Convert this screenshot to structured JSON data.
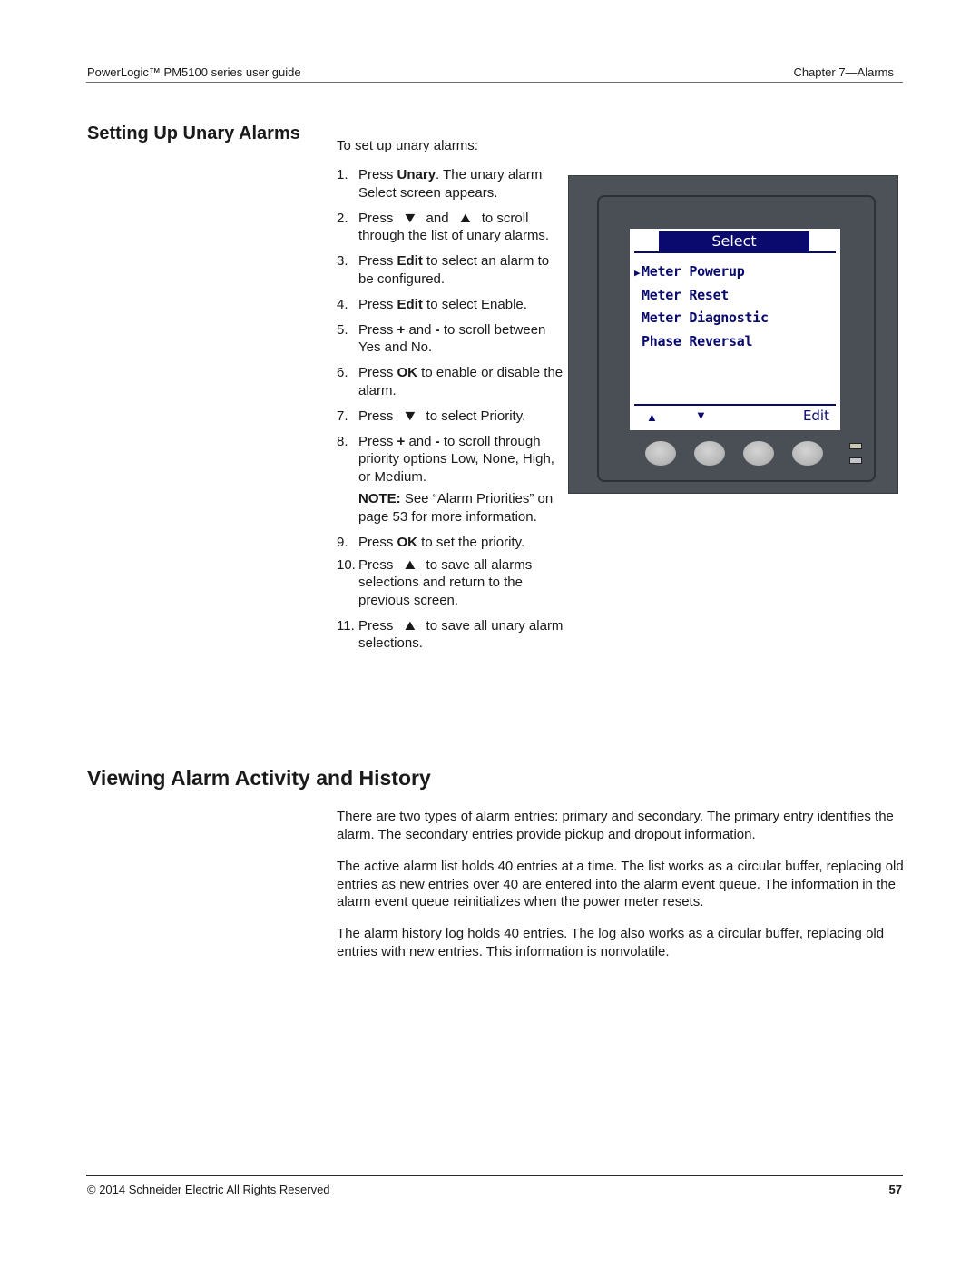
{
  "header": {
    "left": "PowerLogic™  PM5100 series user guide",
    "right": "Chapter 7—Alarms"
  },
  "section1": {
    "title": "Setting Up Unary Alarms",
    "intro": "To set up unary alarms:",
    "steps": [
      {
        "num": "1.",
        "pre": "Press ",
        "bold": "Unary",
        "post": ". The unary alarm Select screen appears."
      },
      {
        "num": "2.",
        "pre": "Press ",
        "icon1": "▼",
        "mid": " and ",
        "icon2": "▲",
        "post": " to scroll through the list of unary alarms."
      },
      {
        "num": "3.",
        "pre": "Press ",
        "bold": "Edit",
        "post": " to select an alarm to be configured."
      },
      {
        "num": "4.",
        "pre": "Press ",
        "bold": "Edit",
        "post": " to select Enable."
      },
      {
        "num": "5.",
        "pre": "Press ",
        "bold": "+",
        "mid": " and ",
        "bold2": "-",
        "post": " to scroll between Yes and No."
      },
      {
        "num": "6.",
        "pre": "Press ",
        "bold": "OK",
        "post": " to enable or disable the alarm."
      },
      {
        "num": "7.",
        "pre": "Press ",
        "icon1": "▼",
        "post": " to select Priority."
      },
      {
        "num": "8.",
        "pre": "Press ",
        "bold": "+",
        "mid": " and ",
        "bold2": "-",
        "post": " to scroll through priority options Low, None, High, or Medium.",
        "note_label": "NOTE:",
        "note_text": " See “Alarm Priorities” on page 53 for more information."
      },
      {
        "num": "9.",
        "pre": "Press ",
        "bold": "OK",
        "post": " to set the priority."
      },
      {
        "num": "10.",
        "pre": "Press ",
        "icon1": "▲",
        "post": " to save all alarms selections and return to the previous screen."
      },
      {
        "num": "11.",
        "pre": "Press ",
        "icon1": "▲",
        "post": " to save all unary alarm selections."
      }
    ]
  },
  "device_screen": {
    "title": "Select",
    "cursor": "▶",
    "items": [
      "Meter Powerup",
      "Meter Reset",
      "Meter Diagnostic",
      "Phase Reversal"
    ],
    "selected_index": 0,
    "softkeys": {
      "up": "▲",
      "down": "▼",
      "edit": "Edit"
    }
  },
  "section2": {
    "title": "Viewing Alarm Activity and History",
    "paragraphs": [
      "There are two types of alarm entries: primary and secondary. The primary entry identifies the alarm. The secondary entries provide pickup and dropout information.",
      "The active alarm list holds 40 entries at a time. The list works as a circular buffer, replacing old entries as new entries over 40 are entered into the alarm event queue. The information in the alarm event queue reinitializes when the power meter resets.",
      "The alarm history log holds 40 entries. The log also works as a circular buffer, replacing old entries with new entries. This information is nonvolatile."
    ]
  },
  "footer": {
    "copyright": "© 2014 Schneider Electric All Rights Reserved",
    "page_number": "57"
  }
}
